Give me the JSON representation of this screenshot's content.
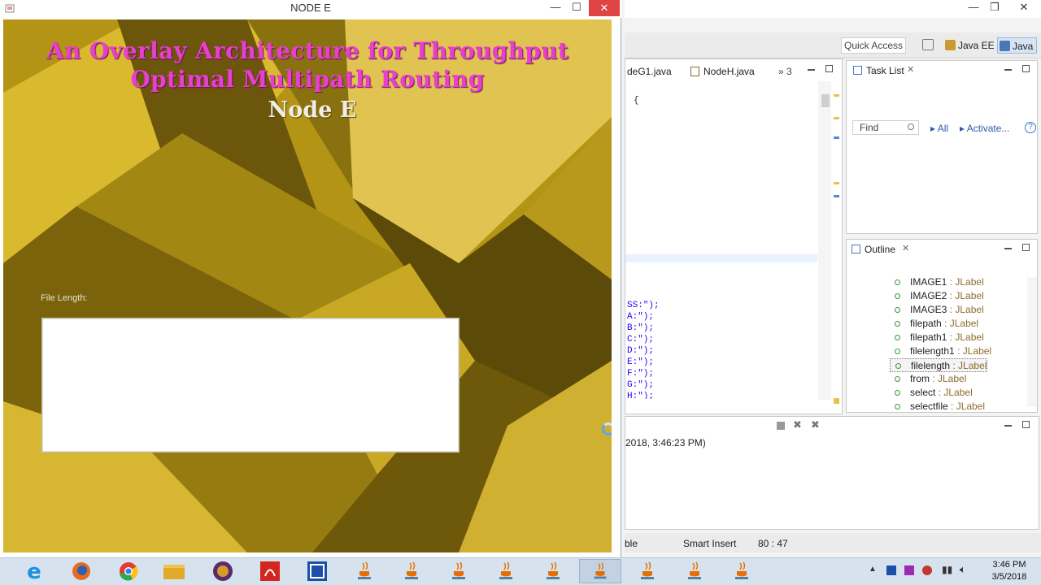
{
  "app": {
    "title": "NODE E",
    "heading_line1": "An Overlay Architecture for Throughput",
    "heading_line2": "Optimal Multipath Routing",
    "node_label": "Node E",
    "file_length_label": "File Length:",
    "controls": {
      "minimize": "—",
      "maximize": "☐",
      "close": "✕"
    }
  },
  "eclipse": {
    "window_controls": {
      "minimize": "—",
      "restore": "❐",
      "close": "✕"
    },
    "quick_access": "Quick Access",
    "perspectives": [
      "Java EE",
      "Java"
    ],
    "editor_tabs": [
      "deG1.java",
      "NodeH.java",
      "3"
    ],
    "code_brace": "{",
    "code_lines": [
      "SS:\");",
      "A:\");",
      "B:\");",
      "C:\");",
      "D:\");",
      "E:\");",
      "F:\");",
      "G:\");",
      "H:\");"
    ],
    "task_list": {
      "title": "Task List",
      "find_placeholder": "Find",
      "filter_all": "All",
      "activate": "Activate..."
    },
    "outline": {
      "title": "Outline",
      "items": [
        {
          "name": "IMAGE1",
          "type": ": JLabel"
        },
        {
          "name": "IMAGE2",
          "type": ": JLabel"
        },
        {
          "name": "IMAGE3",
          "type": ": JLabel"
        },
        {
          "name": "filepath",
          "type": ": JLabel"
        },
        {
          "name": "filepath1",
          "type": ": JLabel"
        },
        {
          "name": "filelength1",
          "type": ": JLabel"
        },
        {
          "name": "filelength",
          "type": ": JLabel"
        },
        {
          "name": "from",
          "type": ": JLabel"
        },
        {
          "name": "select",
          "type": ": JLabel"
        },
        {
          "name": "selectfile",
          "type": ": JLabel"
        }
      ],
      "selected_index": 6
    },
    "console_text": "2018, 3:46:23 PM)",
    "status": {
      "writable": "ble",
      "insert_mode": "Smart Insert",
      "position": "80 : 47"
    }
  },
  "taskbar": {
    "apps": [
      "internet-explorer",
      "firefox",
      "chrome",
      "file-explorer",
      "java-ee-ide",
      "acrobat",
      "remote-app",
      "java-1",
      "java-2",
      "java-3",
      "java-4",
      "java-5",
      "java-6",
      "java-7",
      "java-8",
      "java-9",
      "java-10"
    ],
    "active_index": 12,
    "time": "3:46 PM",
    "date": "3/5/2018"
  },
  "colors": {
    "title_magenta": "#e83fcf",
    "node_label": "#f0ede3",
    "background_gold": "#a9890f"
  }
}
